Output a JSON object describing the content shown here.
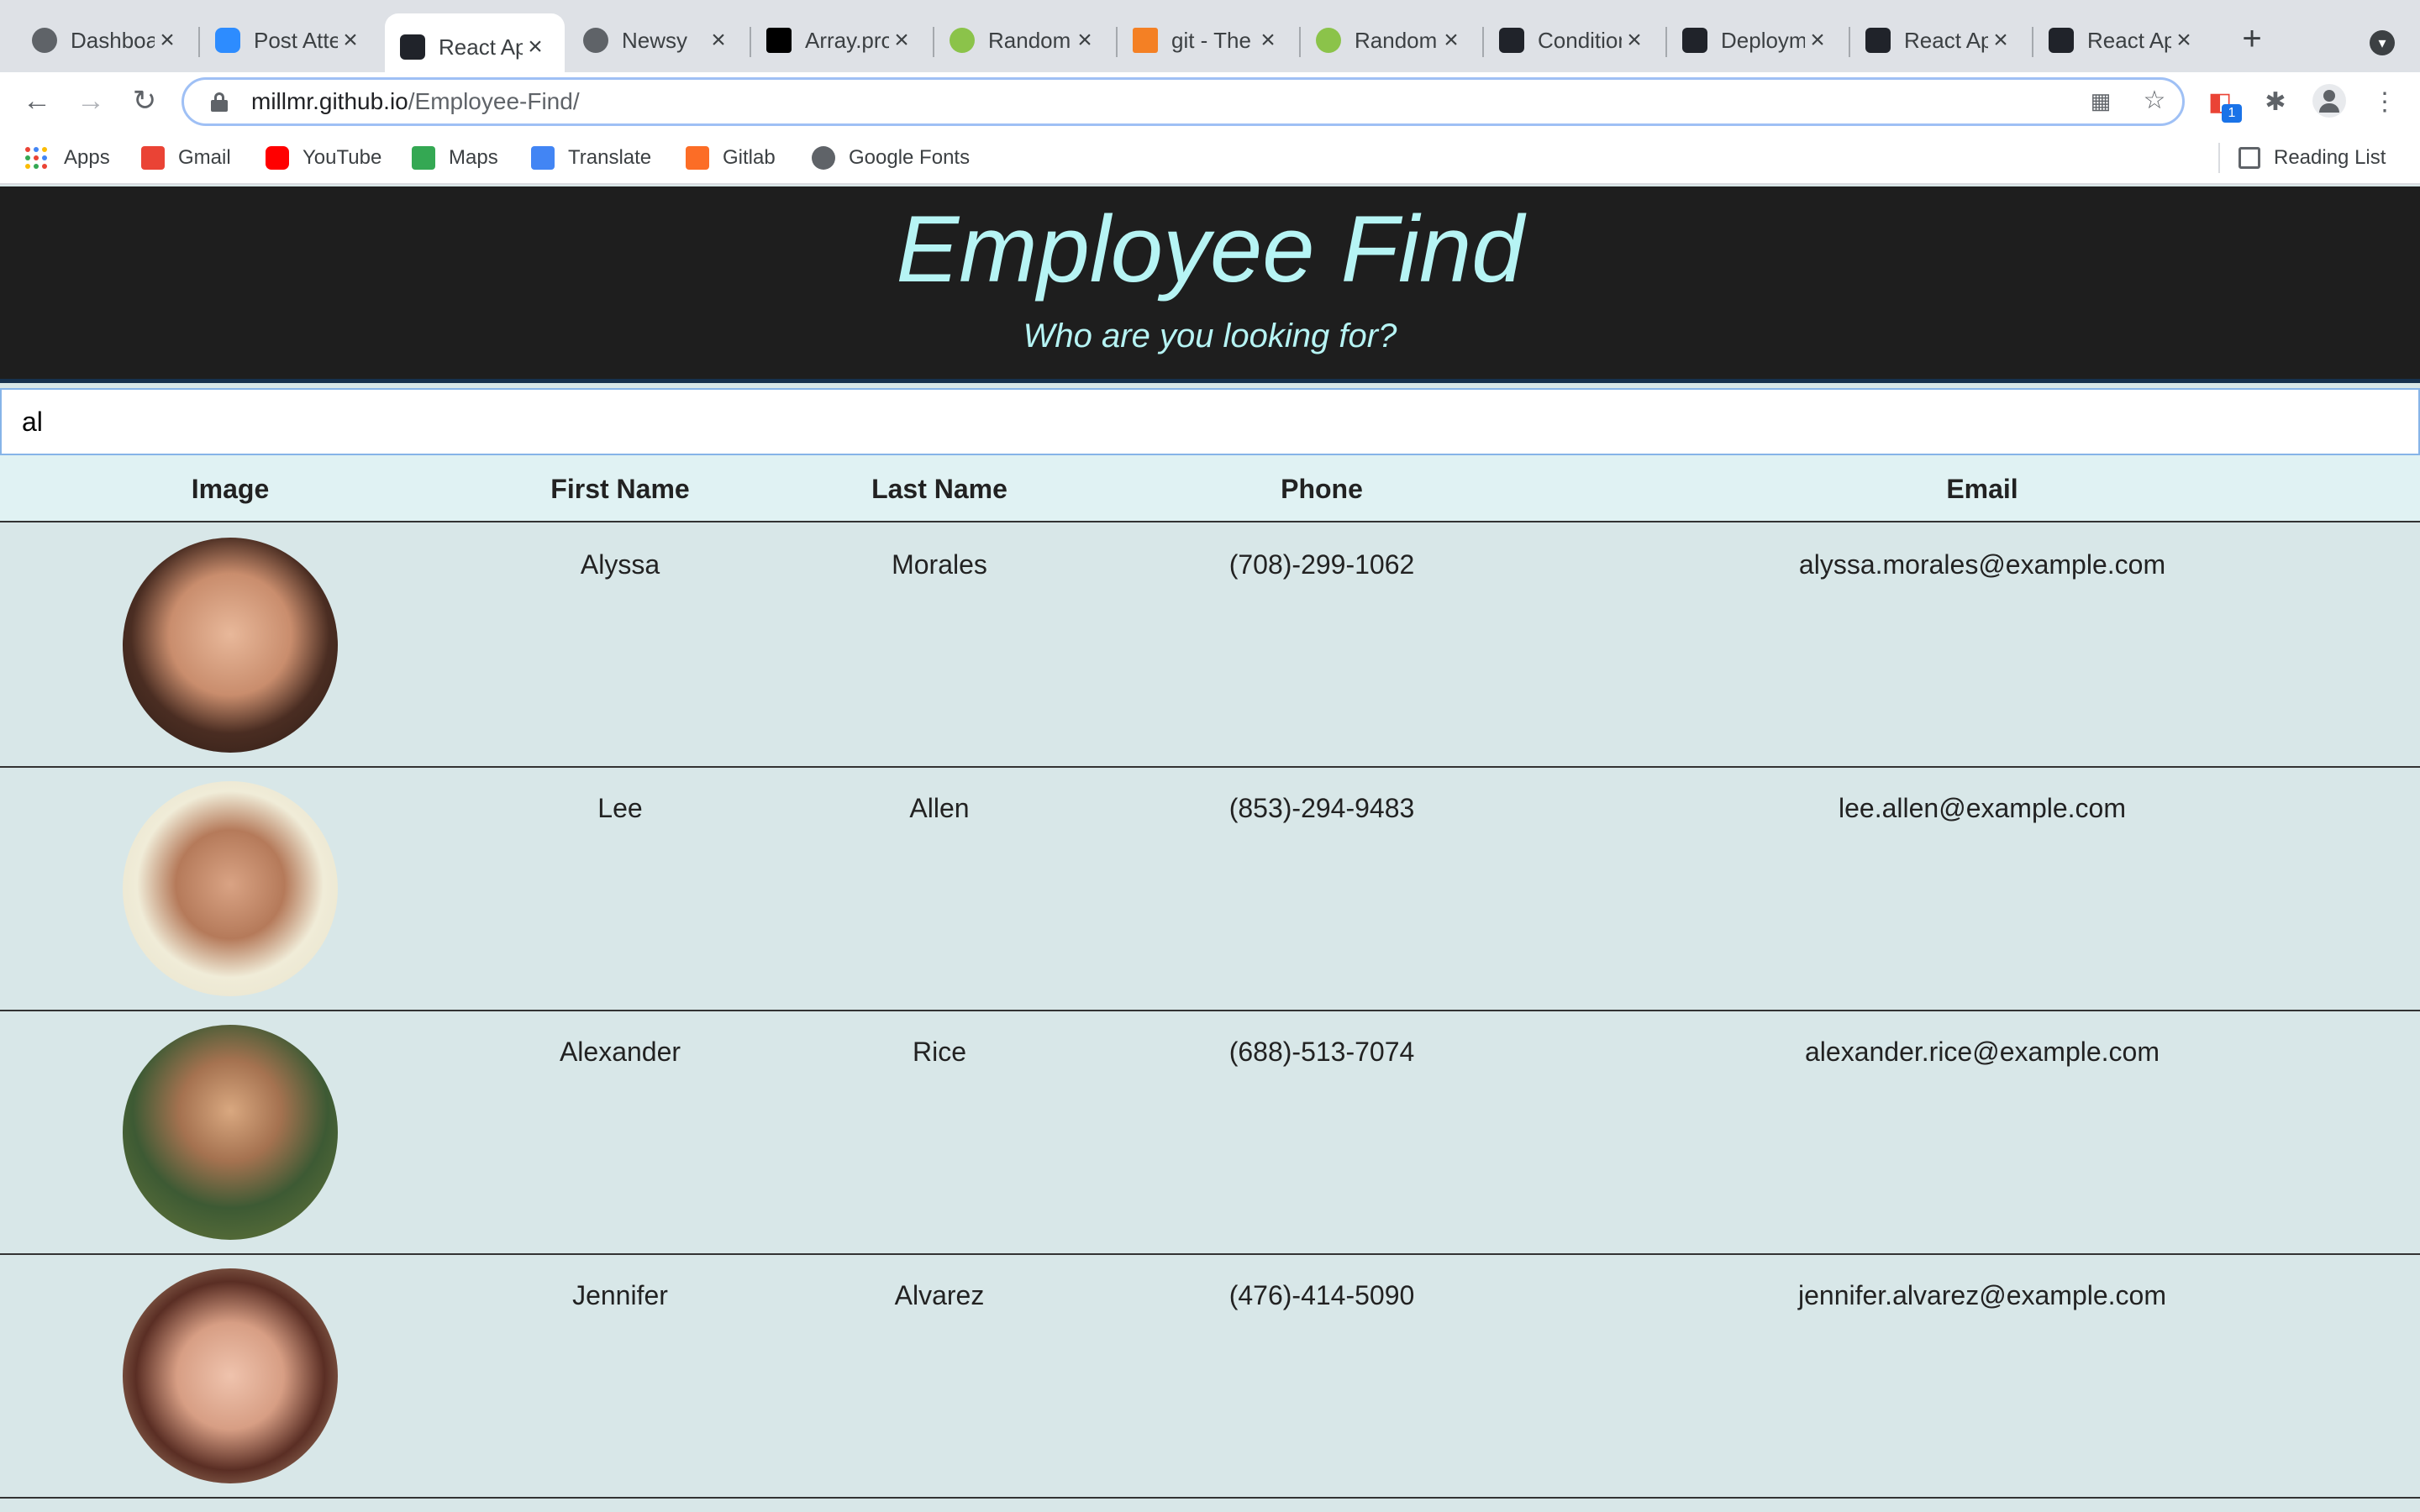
{
  "browser": {
    "tabs": [
      {
        "label": "Dashboard",
        "icon": "globe-icon",
        "color": "#5f6368"
      },
      {
        "label": "Post Attendee",
        "icon": "zoom-icon",
        "color": "#2d8cff"
      },
      {
        "label": "React App",
        "icon": "react-icon",
        "color": "#20232a",
        "active": true
      },
      {
        "label": "Newsy",
        "icon": "globe-icon",
        "color": "#5f6368"
      },
      {
        "label": "Array.prototype",
        "icon": "mdn-icon",
        "color": "#000000"
      },
      {
        "label": "Random User",
        "icon": "randomuser-icon",
        "color": "#8bc34a"
      },
      {
        "label": "git - The",
        "icon": "stackoverflow-icon",
        "color": "#f48024"
      },
      {
        "label": "Random User",
        "icon": "randomuser-icon",
        "color": "#8bc34a"
      },
      {
        "label": "Conditional",
        "icon": "react-icon",
        "color": "#20232a"
      },
      {
        "label": "Deployment",
        "icon": "react-icon",
        "color": "#20232a"
      },
      {
        "label": "React App",
        "icon": "react-icon",
        "color": "#20232a"
      },
      {
        "label": "React App",
        "icon": "react-icon",
        "color": "#20232a"
      }
    ],
    "url_host": "millmr.github.io",
    "url_path": "/Employee-Find/",
    "extension_badge": "1",
    "bookmarks": [
      {
        "label": "Apps",
        "icon": "apps-grid-icon"
      },
      {
        "label": "Gmail",
        "icon": "gmail-icon",
        "color": "#ea4335"
      },
      {
        "label": "YouTube",
        "icon": "youtube-icon",
        "color": "#ff0000"
      },
      {
        "label": "Maps",
        "icon": "maps-icon",
        "color": "#34a853"
      },
      {
        "label": "Translate",
        "icon": "translate-icon",
        "color": "#4285f4"
      },
      {
        "label": "Gitlab",
        "icon": "gitlab-icon",
        "color": "#fc6d26"
      },
      {
        "label": "Google Fonts",
        "icon": "globe-icon",
        "color": "#5f6368"
      }
    ],
    "reading_list": "Reading List"
  },
  "page": {
    "title": "Employee Find",
    "subtitle": "Who are you looking for?",
    "search_value": "al",
    "columns": [
      "Image",
      "First Name",
      "Last Name",
      "Phone",
      "Email"
    ],
    "employees": [
      {
        "first": "Alyssa",
        "last": "Morales",
        "phone": "(708)-299-1062",
        "email": "alyssa.morales@example.com"
      },
      {
        "first": "Lee",
        "last": "Allen",
        "phone": "(853)-294-9483",
        "email": "lee.allen@example.com"
      },
      {
        "first": "Alexander",
        "last": "Rice",
        "phone": "(688)-513-7074",
        "email": "alexander.rice@example.com"
      },
      {
        "first": "Jennifer",
        "last": "Alvarez",
        "phone": "(476)-414-5090",
        "email": "jennifer.alvarez@example.com"
      }
    ],
    "colors": {
      "header_bg": "#1e1e1e",
      "title_color": "#b6f4f4",
      "table_bg": "#d8e7e8",
      "thead_bg": "#e0f2f3"
    }
  }
}
